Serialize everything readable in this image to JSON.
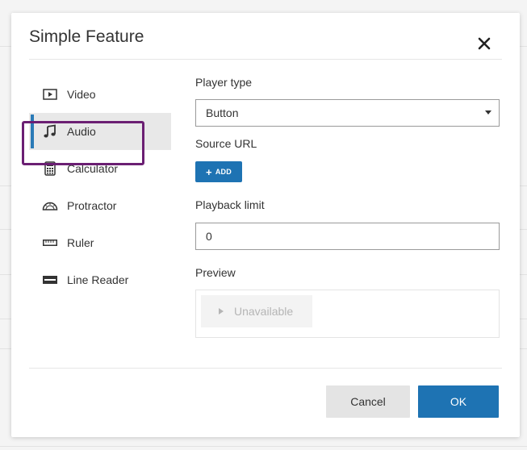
{
  "dialog": {
    "title": "Simple Feature"
  },
  "sidebar": {
    "items": [
      {
        "label": "Video",
        "icon": "video-icon",
        "active": false
      },
      {
        "label": "Audio",
        "icon": "music-note-icon",
        "active": true
      },
      {
        "label": "Calculator",
        "icon": "calculator-icon",
        "active": false
      },
      {
        "label": "Protractor",
        "icon": "protractor-icon",
        "active": false
      },
      {
        "label": "Ruler",
        "icon": "ruler-icon",
        "active": false
      },
      {
        "label": "Line Reader",
        "icon": "line-reader-icon",
        "active": false
      }
    ]
  },
  "form": {
    "player_type": {
      "label": "Player type",
      "value": "Button"
    },
    "source_url": {
      "label": "Source URL",
      "add_label": "ADD"
    },
    "playback_limit": {
      "label": "Playback limit",
      "value": "0"
    },
    "preview": {
      "label": "Preview",
      "button_label": "Unavailable"
    }
  },
  "footer": {
    "cancel_label": "Cancel",
    "ok_label": "OK"
  },
  "colors": {
    "accent": "#1e73b3",
    "focus_ring": "#6b1f73",
    "active_bg": "#e8e8e8",
    "active_bar": "#2a7ab7"
  }
}
